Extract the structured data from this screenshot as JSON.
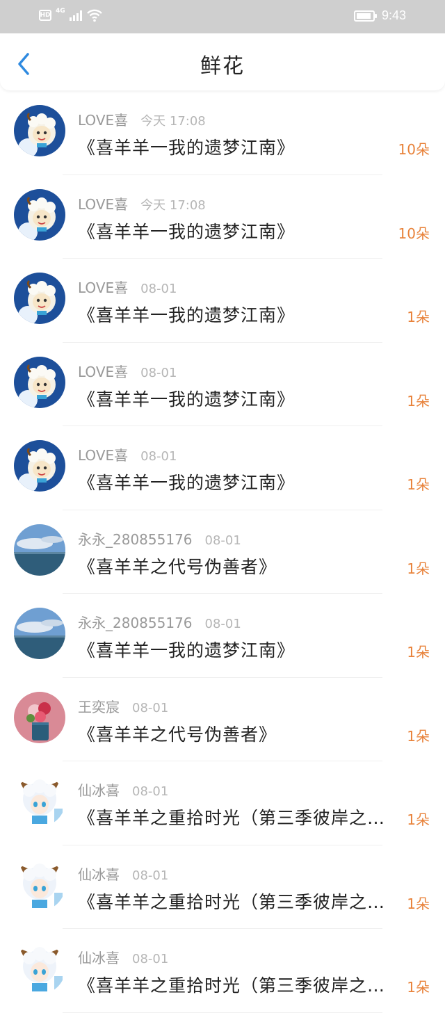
{
  "status_bar": {
    "hd": "HD",
    "network": "4G",
    "time": "9:43",
    "icons": [
      "hd-icon",
      "signal-icon",
      "wifi-icon",
      "battery-icon"
    ]
  },
  "header": {
    "back_icon": "chevron-left-icon",
    "title": "鲜花"
  },
  "colors": {
    "status_bar": "#cfcfcf",
    "accent_blue": "#2f8ae0",
    "count_orange": "#e8823a",
    "meta_gray": "#999999"
  },
  "items": [
    {
      "user": "LOVE喜",
      "time": "今天 17:08",
      "title": "《喜羊羊一我的遗梦江南》",
      "count": "10朵",
      "avatar": "goat-cartoon"
    },
    {
      "user": "LOVE喜",
      "time": "今天 17:08",
      "title": "《喜羊羊一我的遗梦江南》",
      "count": "10朵",
      "avatar": "goat-cartoon"
    },
    {
      "user": "LOVE喜",
      "time": "08-01",
      "title": "《喜羊羊一我的遗梦江南》",
      "count": "1朵",
      "avatar": "goat-cartoon"
    },
    {
      "user": "LOVE喜",
      "time": "08-01",
      "title": "《喜羊羊一我的遗梦江南》",
      "count": "1朵",
      "avatar": "goat-cartoon"
    },
    {
      "user": "LOVE喜",
      "time": "08-01",
      "title": "《喜羊羊一我的遗梦江南》",
      "count": "1朵",
      "avatar": "goat-cartoon"
    },
    {
      "user": "永永_280855176",
      "time": "08-01",
      "title": "《喜羊羊之代号伪善者》",
      "count": "1朵",
      "avatar": "sea-sky"
    },
    {
      "user": "永永_280855176",
      "time": "08-01",
      "title": "《喜羊羊一我的遗梦江南》",
      "count": "1朵",
      "avatar": "sea-sky"
    },
    {
      "user": "王奕宸",
      "time": "08-01",
      "title": "《喜羊羊之代号伪善者》",
      "count": "1朵",
      "avatar": "flowers"
    },
    {
      "user": "仙冰喜",
      "time": "08-01",
      "title": "《喜羊羊之重拾时光（第三季彼岸之…",
      "count": "1朵",
      "avatar": "anime-goat"
    },
    {
      "user": "仙冰喜",
      "time": "08-01",
      "title": "《喜羊羊之重拾时光（第三季彼岸之…",
      "count": "1朵",
      "avatar": "anime-goat"
    },
    {
      "user": "仙冰喜",
      "time": "08-01",
      "title": "《喜羊羊之重拾时光（第三季彼岸之…",
      "count": "1朵",
      "avatar": "anime-goat"
    }
  ]
}
